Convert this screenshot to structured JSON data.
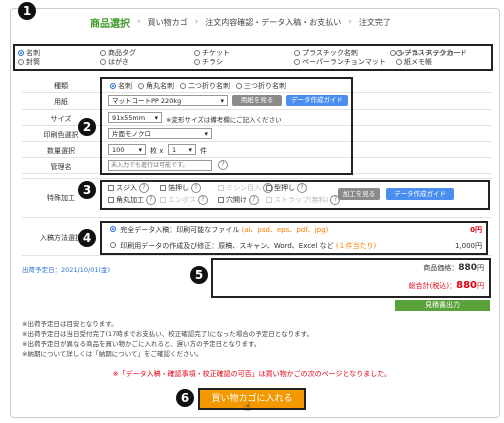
{
  "steps": {
    "current": "商品選択",
    "others": [
      "買い物カゴ",
      "注文内容確認・データ入稿・お支払い",
      "注文完了"
    ]
  },
  "product_types": [
    {
      "label": "名刺",
      "selected": true
    },
    {
      "label": "商品タグ",
      "selected": false
    },
    {
      "label": "チケット",
      "selected": false
    },
    {
      "label": "プラスチック名刺",
      "selected": false
    },
    {
      "label": "プラスチックカード",
      "selected": false
    },
    {
      "label": "シール・ステッカー",
      "selected": false
    },
    {
      "label": "封筒",
      "selected": false
    },
    {
      "label": "はがき",
      "selected": false
    },
    {
      "label": "チラシ",
      "selected": false
    },
    {
      "label": "ペーパーランチョンマット",
      "selected": false
    },
    {
      "label": "紙メモ帳",
      "selected": false
    }
  ],
  "form": {
    "kind_label": "種類",
    "kinds": [
      {
        "label": "名刺",
        "selected": true
      },
      {
        "label": "角丸名刺",
        "selected": false
      },
      {
        "label": "二つ折り名刺",
        "selected": false
      },
      {
        "label": "三つ折り名刺",
        "selected": false
      }
    ],
    "paper_label": "用紙",
    "paper_value": "マットコートPP 220kg",
    "paper_view_btn": "用紙を見る",
    "guide_btn": "データ作成ガイド",
    "size_label": "サイズ",
    "size_value": "91x55mm",
    "size_note": "※変形サイズは備考欄にご記入ください",
    "color_label": "印刷色選択",
    "color_value": "片面モノクロ",
    "qty_label": "数量選択",
    "qty_value": "100",
    "qty_unit1": "枚 x",
    "qty_value2": "1",
    "qty_unit2": "件",
    "name_label": "管理名",
    "name_placeholder": "未入力でも進行は可能です。"
  },
  "special": {
    "label": "特殊加工",
    "options": [
      {
        "label": "スジ入",
        "enabled": true
      },
      {
        "label": "箔押し",
        "enabled": true
      },
      {
        "label": "ミシン目入",
        "enabled": false
      },
      {
        "label": "型押し",
        "enabled": true
      },
      {
        "label": "角丸加工",
        "enabled": true
      },
      {
        "label": "エンボス",
        "enabled": false
      },
      {
        "label": "穴開け",
        "enabled": true
      },
      {
        "label": "ストラップ(無料)",
        "enabled": false
      }
    ],
    "view_btn": "加工を見る",
    "guide_btn": "データ作成ガイド"
  },
  "submission": {
    "label": "入稿方法選択",
    "option1": "完全データ入稿：印刷可能なファイル",
    "option1_formats": "(ai、psd、eps、pdf、jpg)",
    "option1_price": "0円",
    "option2": "印刷用データの作成及び修正：原稿、スキャン、Word、Excel など",
    "option2_note": "(１件当たり)",
    "option2_price": "1,000円"
  },
  "summary": {
    "ship_date": "出荷予定日：2021/10/01(金)",
    "price_label": "商品価格：",
    "price_value": "880",
    "price_unit": "円",
    "total_label": "総合計(税込)：",
    "total_value": "880",
    "total_unit": "円",
    "quote_btn": "見積書出力"
  },
  "notes": [
    "※出荷予定日は目安となります。",
    "※出荷予定日は当日受付完了(17時までお支払い、校正確認完了)になった場合の予定日となります。",
    "※出荷予定日が異なる商品を買い物かごに入れると、遅い方の予定日となります。",
    "※納期について詳しくは「納期について」をご確認ください。"
  ],
  "warning": "※「データ入稿・確認事項・校正確認の可否」は買い物かごの次のページとなりました。",
  "cart_btn": "買い物カゴに入れる",
  "badges": [
    "1",
    "2",
    "3",
    "4",
    "5",
    "6"
  ],
  "colors": {
    "accent_green": "#3f9b2c",
    "price_red": "#e60012",
    "cart_orange": "#f39800",
    "guide_blue": "#4a8ff0"
  }
}
